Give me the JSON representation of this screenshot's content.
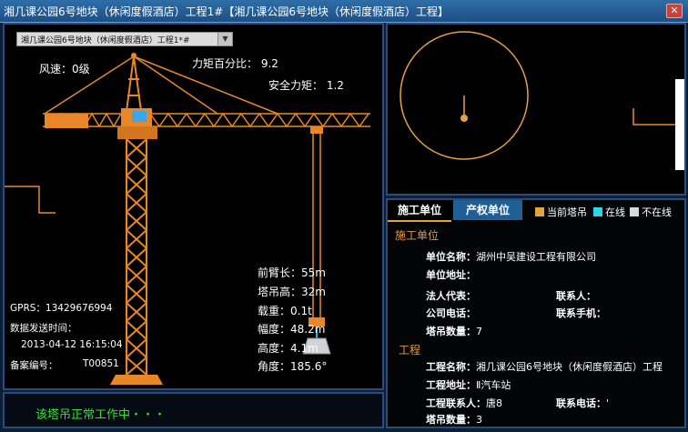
{
  "window": {
    "title": "湘几课公园6号地块（休闲度假酒店）工程1#【湘几课公园6号地块（休闲度假酒店）工程】",
    "close": "✕"
  },
  "crane_view": {
    "selector_value": "湘几课公园6号地块（休闲度假酒店）工程1*#",
    "wind": "风速：0级",
    "torque_percent": "力矩百分比： 9.2",
    "safe_torque": "安全力矩： 1.2",
    "front_arm": "前臂长：55m",
    "tower_height": "塔吊高：32m",
    "load": "载重：0.1t",
    "amplitude": "幅度：48.2m",
    "height": "高度：4.1m",
    "angle": "角度：185.6°",
    "gprs": "GPRS：13429676994",
    "send_time_label": "数据发送时间：",
    "send_time": "2013-04-12 16:15:04",
    "record_no_label": "备案编号：",
    "record_no": "T00851"
  },
  "status": {
    "text": "该塔吊正常工作中・・・"
  },
  "info_panel": {
    "tab_construction": "施工单位",
    "tab_ownership": "产权单位",
    "legend": [
      {
        "label": "当前塔吊",
        "color": "#e3a53a"
      },
      {
        "label": "在线",
        "color": "#28d6e8"
      },
      {
        "label": "不在线",
        "color": "#d8d8d8"
      }
    ],
    "unit_section_title": "施工单位",
    "unit_name_label": "单位名称：",
    "unit_name": "湖州中吴建设工程有限公司",
    "unit_address_label": "单位地址：",
    "legal_rep_label": "法人代表：",
    "contact_label": "联系人：",
    "company_phone_label": "公司电话：",
    "contact_mobile_label": "联系手机：",
    "crane_count_label": "塔吊数量：",
    "crane_count": "7",
    "project_section_title": "工程",
    "project_name_label": "工程名称：",
    "project_name": "湘几课公园6号地块（休闲度假酒店）工程",
    "project_address_label": "工程地址：",
    "project_address": "Ⅱ汽车站",
    "project_contact_label": "工程联系人：",
    "project_contact": "唐8",
    "project_phone_label": "联系电话：",
    "project_phone": "'",
    "project_crane_count_label": "塔吊数量：",
    "project_crane_count": "3"
  },
  "colors": {
    "crane_orange": "#e8872a",
    "status_green": "#33e033",
    "section_orange": "#e89a40"
  }
}
